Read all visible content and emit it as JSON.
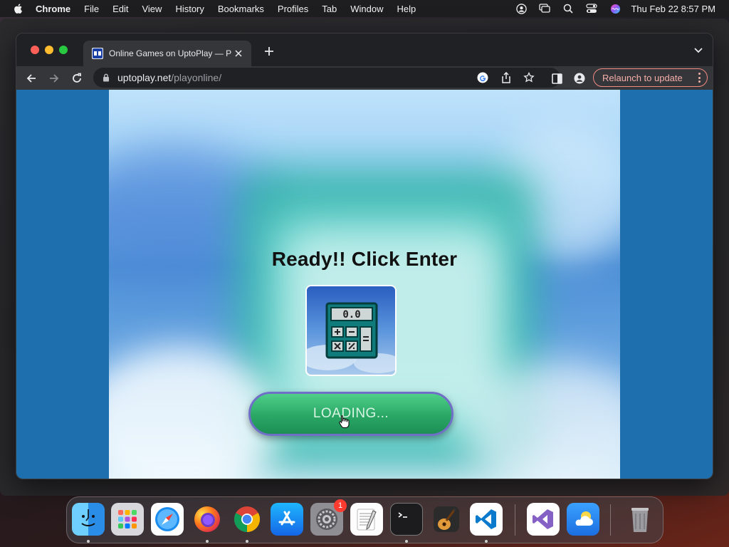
{
  "menubar": {
    "app": "Chrome",
    "items": [
      "File",
      "Edit",
      "View",
      "History",
      "Bookmarks",
      "Profiles",
      "Tab",
      "Window",
      "Help"
    ],
    "clock": "Thu Feb 22  8:57 PM"
  },
  "browser": {
    "tab_title": "Online Games on UptoPlay — P",
    "url_host": "uptoplay.net",
    "url_path": "/playonline/",
    "relaunch_label": "Relaunch to update"
  },
  "game": {
    "heading": "Ready!! Click Enter",
    "display_value": "0.0",
    "button_label": "LOADING..."
  },
  "dock": {
    "apps": [
      "finder-icon",
      "launchpad-icon",
      "safari-icon",
      "firefox-icon",
      "chrome-icon",
      "app-store-icon",
      "system-settings-icon",
      "textedit-icon",
      "terminal-icon",
      "garageband-icon",
      "vscode-icon",
      "visual-studio-icon",
      "weather-icon",
      "trash-icon"
    ],
    "settings_badge": "1"
  },
  "colors": {
    "page_bg": "#1e6fad",
    "button_green": "#2aa765",
    "relaunch_accent": "#f28b82"
  }
}
